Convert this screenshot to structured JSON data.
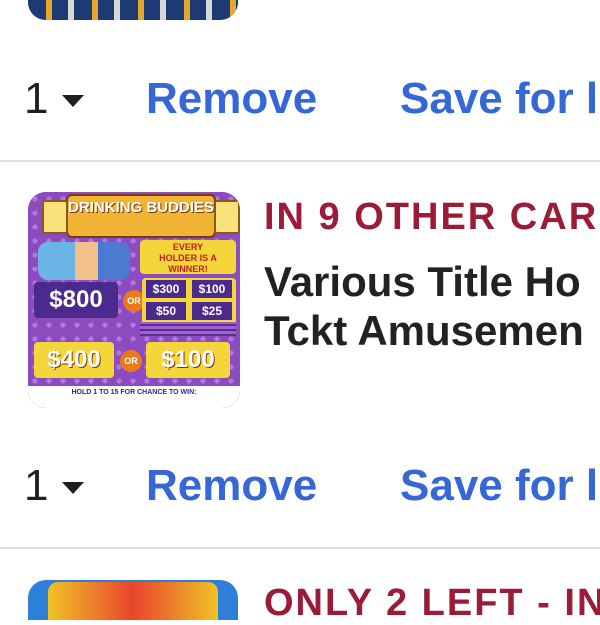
{
  "items": [
    {
      "quantity": "1",
      "remove_label": "Remove",
      "save_label": "Save for l"
    },
    {
      "notice": "IN 9 OTHER CAR",
      "title_line1": "Various Title Ho",
      "title_line2": "Tckt Amusemen",
      "quantity": "1",
      "remove_label": "Remove",
      "save_label": "Save for l",
      "ticket": {
        "header": "DRINKING BUDDIES",
        "holder_text": "EVERY HOLDER IS A WINNER!",
        "prize_800": "$800",
        "prize_400": "$400",
        "prize_100_big": "$100",
        "prize_300": "$300",
        "prize_100": "$100",
        "prize_50": "$50",
        "prize_25": "$25",
        "or": "OR",
        "footer": "HOLD 1 TO 15 FOR CHANCE TO WIN:"
      }
    },
    {
      "notice": "ONLY 2 LEFT - IN"
    }
  ],
  "colors": {
    "link": "#3567d6",
    "notice": "#9a1c36",
    "text": "#222222",
    "divider": "#dddddd"
  }
}
